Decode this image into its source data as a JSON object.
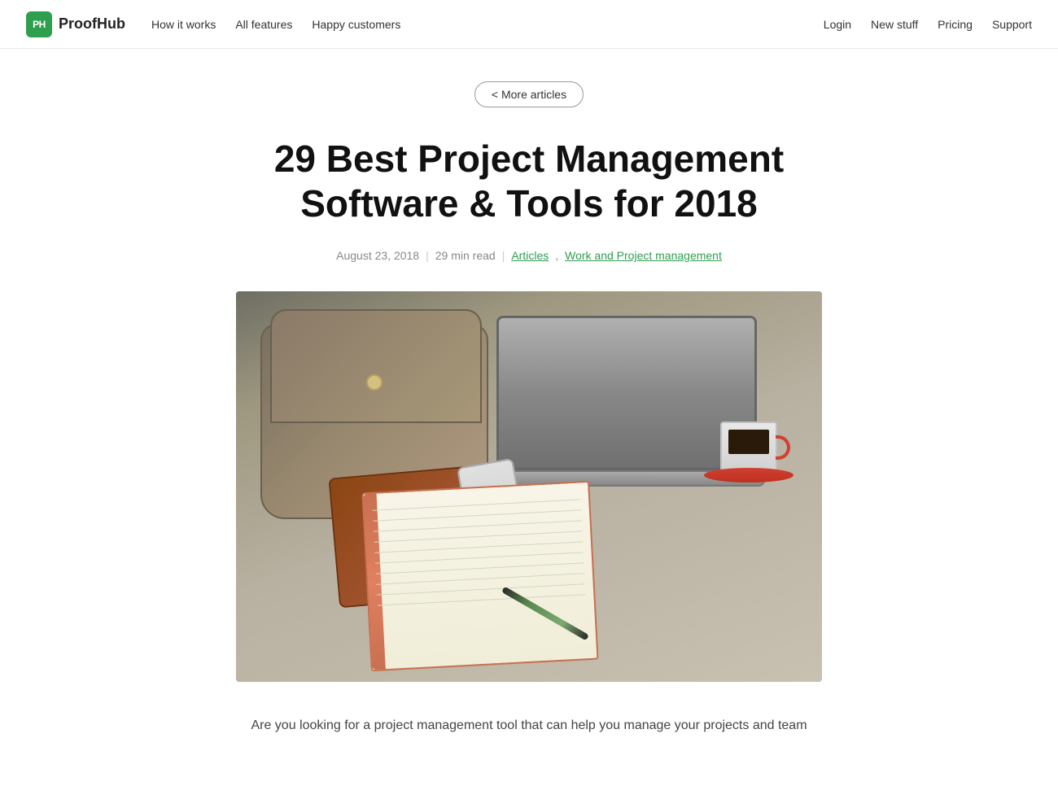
{
  "nav": {
    "logo": {
      "icon_text": "PH",
      "name": "ProofHub"
    },
    "left_links": [
      {
        "label": "How it works",
        "id": "how-it-works"
      },
      {
        "label": "All features",
        "id": "all-features"
      },
      {
        "label": "Happy customers",
        "id": "happy-customers"
      }
    ],
    "right_links": [
      {
        "label": "Login",
        "id": "login"
      },
      {
        "label": "New stuff",
        "id": "new-stuff"
      },
      {
        "label": "Pricing",
        "id": "pricing"
      },
      {
        "label": "Support",
        "id": "support"
      }
    ]
  },
  "article": {
    "back_button": "< More articles",
    "title": "29 Best Project Management Software & Tools for 2018",
    "date": "August 23, 2018",
    "read_time": "29 min read",
    "category1": "Articles",
    "category2": "Work and Project management",
    "intro": "Are you looking for a project management tool that can help you manage your projects and team"
  },
  "colors": {
    "green": "#2e9e4f",
    "link_green": "#2e9e4f",
    "logo_bg": "#2e9e4f"
  }
}
